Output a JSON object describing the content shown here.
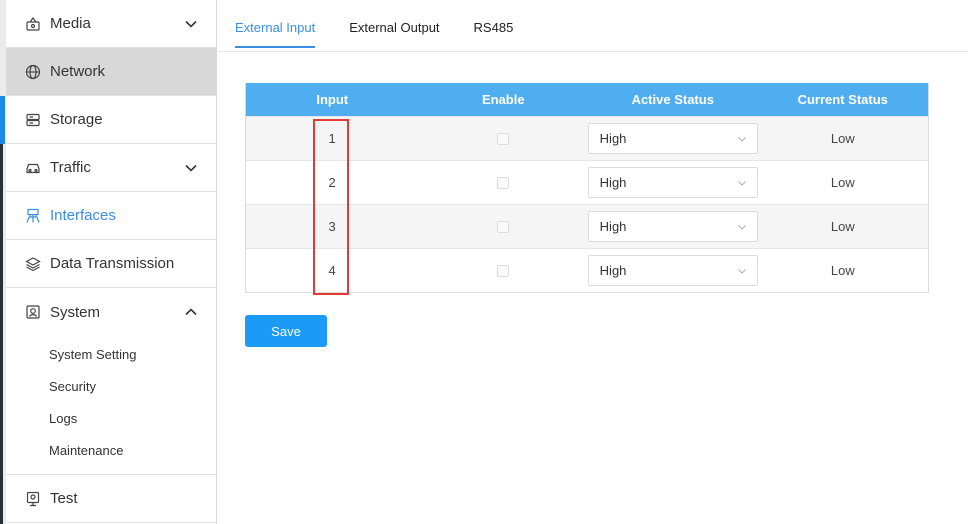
{
  "sidebar": {
    "items": [
      {
        "label": "Media",
        "icon": "media-icon",
        "chevron": "down"
      },
      {
        "label": "Network",
        "icon": "globe-icon"
      },
      {
        "label": "Storage",
        "icon": "storage-icon"
      },
      {
        "label": "Traffic",
        "icon": "car-icon",
        "chevron": "down"
      },
      {
        "label": "Interfaces",
        "icon": "interfaces-icon"
      },
      {
        "label": "Data Transmission",
        "icon": "layers-icon"
      },
      {
        "label": "System",
        "icon": "system-icon",
        "chevron": "up"
      },
      {
        "label": "Test",
        "icon": "test-icon"
      }
    ],
    "system_submenu": [
      "System Setting",
      "Security",
      "Logs",
      "Maintenance"
    ]
  },
  "tabs": [
    "External Input",
    "External Output",
    "RS485"
  ],
  "table": {
    "headers": [
      "Input",
      "Enable",
      "Active Status",
      "Current Status"
    ],
    "rows": [
      {
        "input": "1",
        "active_status": "High",
        "current_status": "Low"
      },
      {
        "input": "2",
        "active_status": "High",
        "current_status": "Low"
      },
      {
        "input": "3",
        "active_status": "High",
        "current_status": "Low"
      },
      {
        "input": "4",
        "active_status": "High",
        "current_status": "Low"
      }
    ]
  },
  "save_label": "Save",
  "colors": {
    "accent": "#3a8ee6",
    "header": "#4faef0",
    "button": "#1b9af7",
    "highlight_box": "#e53935"
  }
}
